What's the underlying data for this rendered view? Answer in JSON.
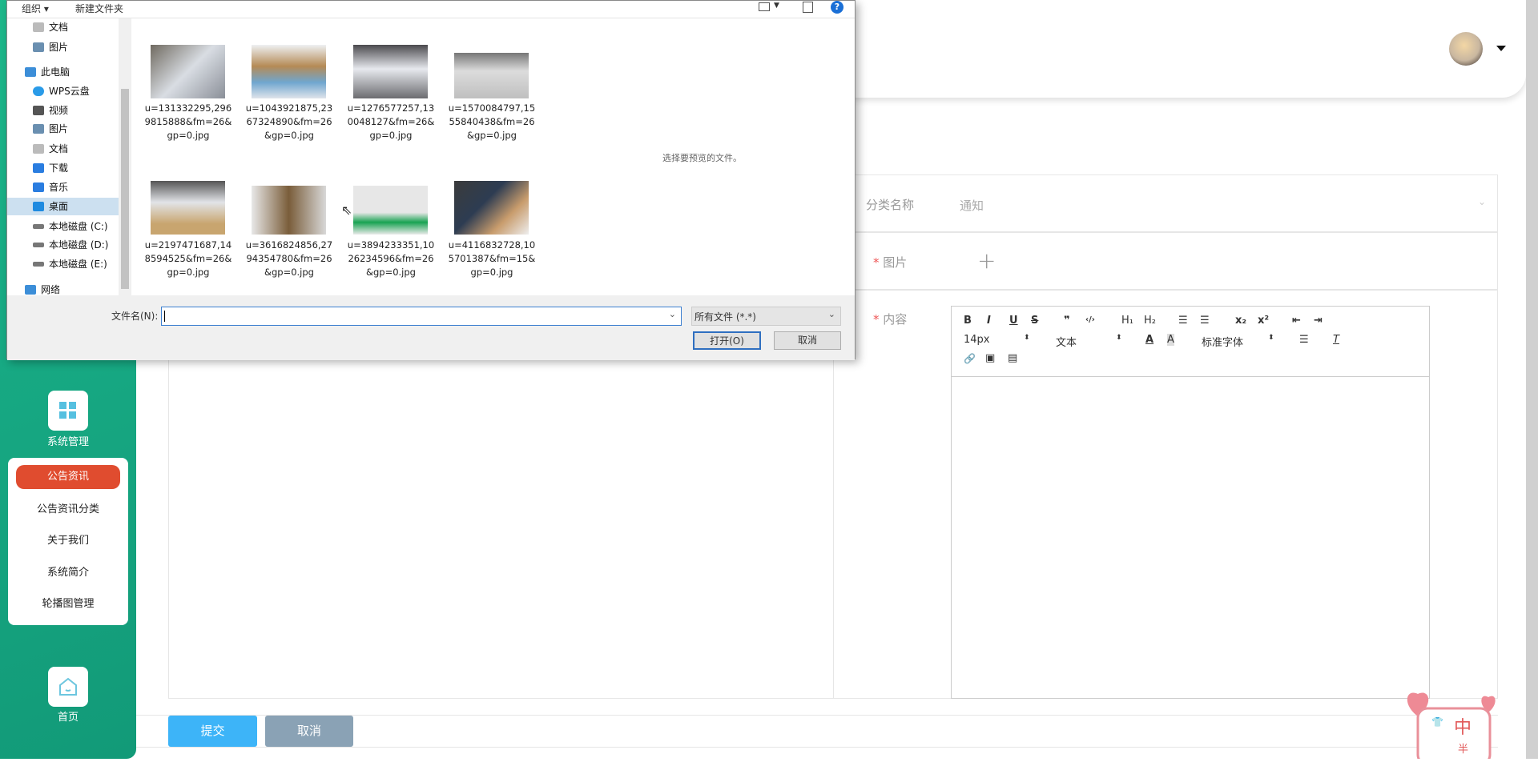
{
  "sidebar": {
    "system_label": "系统管理",
    "home_label": "首页",
    "menu": [
      {
        "label": "公告资讯",
        "active": true
      },
      {
        "label": "公告资讯分类"
      },
      {
        "label": "关于我们"
      },
      {
        "label": "系统简介"
      },
      {
        "label": "轮播图管理"
      }
    ],
    "accent": "#e04c2f",
    "bg": "#17a983"
  },
  "form": {
    "category_label": "分类名称",
    "category_value": "通知",
    "image_label": "图片",
    "content_label": "内容",
    "required_mark": "*",
    "submit": "提交",
    "cancel": "取消"
  },
  "editor": {
    "row1": [
      "B",
      "I",
      "U",
      "S",
      "❞",
      "‹/›",
      "H₁",
      "H₂",
      "☰",
      "☰",
      "x₂",
      "x²",
      "⇤",
      "⇥"
    ],
    "font_size": "14px",
    "block": "文本",
    "font_family": "标准字体",
    "row3": [
      "🔗",
      "▣",
      "▤"
    ]
  },
  "dialog": {
    "organize": "组织 ▾",
    "new_folder": "新建文件夹",
    "help": "?",
    "nav": [
      {
        "label": "文档",
        "indent": 1,
        "color": "#aaa"
      },
      {
        "label": "图片",
        "indent": 1,
        "color": "#6a8fb0"
      },
      {
        "label": "此电脑",
        "indent": 0,
        "color": "#3c8ed8"
      },
      {
        "label": "WPS云盘",
        "indent": 1,
        "color": "#2a9be8"
      },
      {
        "label": "视频",
        "indent": 1,
        "color": "#555"
      },
      {
        "label": "图片",
        "indent": 1,
        "color": "#6a8fb0"
      },
      {
        "label": "文档",
        "indent": 1,
        "color": "#aaa"
      },
      {
        "label": "下载",
        "indent": 1,
        "color": "#2a7de0"
      },
      {
        "label": "音乐",
        "indent": 1,
        "color": "#2a7de0"
      },
      {
        "label": "桌面",
        "indent": 1,
        "color": "#1e8ae0",
        "selected": true
      },
      {
        "label": "本地磁盘 (C:)",
        "indent": 1,
        "color": "#777"
      },
      {
        "label": "本地磁盘 (D:)",
        "indent": 1,
        "color": "#777"
      },
      {
        "label": "本地磁盘 (E:)",
        "indent": 1,
        "color": "#777"
      },
      {
        "label": "网络",
        "indent": 0,
        "color": "#3c8ed8"
      }
    ],
    "files": [
      "u=131332295,2969815888&fm=26&gp=0.jpg",
      "u=1043921875,2367324890&fm=26&gp=0.jpg",
      "u=1276577257,130048127&fm=26&gp=0.jpg",
      "u=1570084797,1555840438&fm=26&gp=0.jpg",
      "u=2197471687,148594525&fm=26&gp=0.jpg",
      "u=3616824856,2794354780&fm=26&gp=0.jpg",
      "u=3894233351,1026234596&fm=26&gp=0.jpg",
      "u=4116832728,105701387&fm=15&gp=0.jpg"
    ],
    "preview_hint": "选择要预览的文件。",
    "filename_label": "文件名(N):",
    "filename_value": "",
    "filter": "所有文件 (*.*)",
    "open": "打开(O)",
    "cancel": "取消"
  },
  "badge": {
    "text1": "中",
    "text2": "半"
  }
}
